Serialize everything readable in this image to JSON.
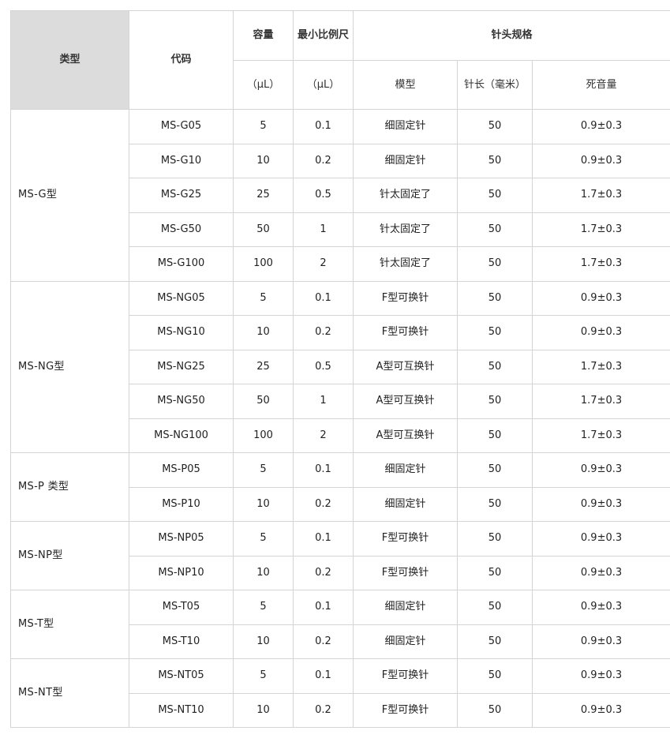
{
  "headers": {
    "type": "类型",
    "code": "代码",
    "capacity": "容量",
    "capacity_unit": "（μL）",
    "min_scale": "最小比例尺",
    "min_scale_unit": "（μL）",
    "needle_spec": "针头规格",
    "model": "模型",
    "needle_length": "针长（毫米）",
    "dead_volume": "死音量"
  },
  "groups": [
    {
      "type": "MS-G型",
      "rows": [
        {
          "code": "MS-G05",
          "capacity": "5",
          "scale": "0.1",
          "model": "细固定针",
          "length": "50",
          "dead": "0.9±0.3"
        },
        {
          "code": "MS-G10",
          "capacity": "10",
          "scale": "0.2",
          "model": "细固定针",
          "length": "50",
          "dead": "0.9±0.3"
        },
        {
          "code": "MS-G25",
          "capacity": "25",
          "scale": "0.5",
          "model": "针太固定了",
          "length": "50",
          "dead": "1.7±0.3"
        },
        {
          "code": "MS-G50",
          "capacity": "50",
          "scale": "1",
          "model": "针太固定了",
          "length": "50",
          "dead": "1.7±0.3"
        },
        {
          "code": "MS-G100",
          "capacity": "100",
          "scale": "2",
          "model": "针太固定了",
          "length": "50",
          "dead": "1.7±0.3"
        }
      ]
    },
    {
      "type": "MS-NG型",
      "rows": [
        {
          "code": "MS-NG05",
          "capacity": "5",
          "scale": "0.1",
          "model": "F型可换针",
          "length": "50",
          "dead": "0.9±0.3"
        },
        {
          "code": "MS-NG10",
          "capacity": "10",
          "scale": "0.2",
          "model": "F型可换针",
          "length": "50",
          "dead": "0.9±0.3"
        },
        {
          "code": "MS-NG25",
          "capacity": "25",
          "scale": "0.5",
          "model": "A型可互换针",
          "length": "50",
          "dead": "1.7±0.3"
        },
        {
          "code": "MS-NG50",
          "capacity": "50",
          "scale": "1",
          "model": "A型可互换针",
          "length": "50",
          "dead": "1.7±0.3"
        },
        {
          "code": "MS-NG100",
          "capacity": "100",
          "scale": "2",
          "model": "A型可互换针",
          "length": "50",
          "dead": "1.7±0.3"
        }
      ]
    },
    {
      "type": "MS-P 类型",
      "rows": [
        {
          "code": "MS-P05",
          "capacity": "5",
          "scale": "0.1",
          "model": "细固定针",
          "length": "50",
          "dead": "0.9±0.3"
        },
        {
          "code": "MS-P10",
          "capacity": "10",
          "scale": "0.2",
          "model": "细固定针",
          "length": "50",
          "dead": "0.9±0.3"
        }
      ]
    },
    {
      "type": "MS-NP型",
      "rows": [
        {
          "code": "MS-NP05",
          "capacity": "5",
          "scale": "0.1",
          "model": "F型可换针",
          "length": "50",
          "dead": "0.9±0.3"
        },
        {
          "code": "MS-NP10",
          "capacity": "10",
          "scale": "0.2",
          "model": "F型可换针",
          "length": "50",
          "dead": "0.9±0.3"
        }
      ]
    },
    {
      "type": "MS-T型",
      "rows": [
        {
          "code": "MS-T05",
          "capacity": "5",
          "scale": "0.1",
          "model": "细固定针",
          "length": "50",
          "dead": "0.9±0.3"
        },
        {
          "code": "MS-T10",
          "capacity": "10",
          "scale": "0.2",
          "model": "细固定针",
          "length": "50",
          "dead": "0.9±0.3"
        }
      ]
    },
    {
      "type": "MS-NT型",
      "rows": [
        {
          "code": "MS-NT05",
          "capacity": "5",
          "scale": "0.1",
          "model": "F型可换针",
          "length": "50",
          "dead": "0.9±0.3"
        },
        {
          "code": "MS-NT10",
          "capacity": "10",
          "scale": "0.2",
          "model": "F型可换针",
          "length": "50",
          "dead": "0.9±0.3"
        }
      ]
    }
  ]
}
